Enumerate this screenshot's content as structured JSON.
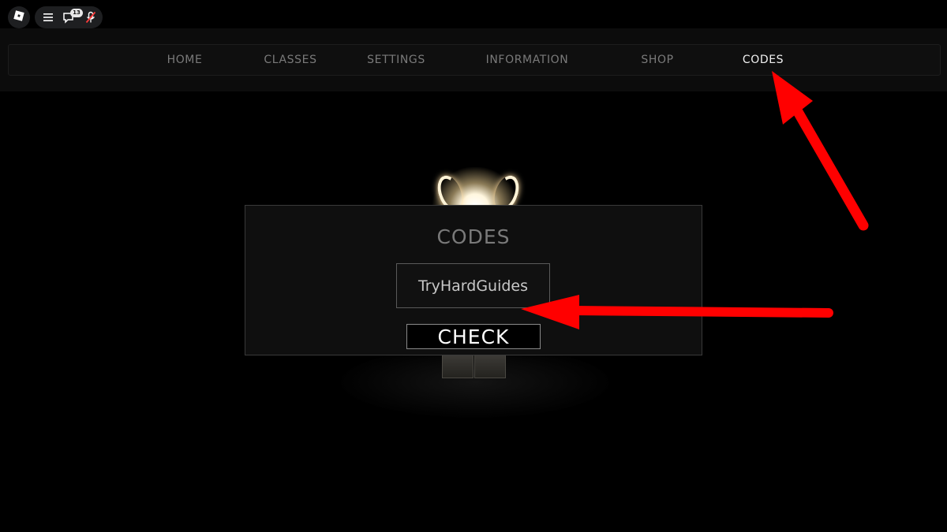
{
  "topbar": {
    "logo_icon": "roblox-logo-icon",
    "menu_icon": "hamburger-menu-icon",
    "chat_icon": "chat-icon",
    "chat_badge": "13",
    "mic_icon": "microphone-muted-icon"
  },
  "nav": {
    "items": [
      {
        "label": "HOME",
        "active": false
      },
      {
        "label": "CLASSES",
        "active": false
      },
      {
        "label": "SETTINGS",
        "active": false
      },
      {
        "label": "INFORMATION",
        "active": false
      },
      {
        "label": "SHOP",
        "active": false
      },
      {
        "label": "CODES",
        "active": true
      }
    ]
  },
  "dialog": {
    "title": "CODES",
    "input_value": "TryHardGuides",
    "check_label": "CHECK"
  },
  "annotations": {
    "arrow_color": "#ff0000",
    "arrow_icon": "red-arrow-icon"
  },
  "colors": {
    "background": "#000000",
    "nav_active": "#f0f0f0",
    "nav_inactive": "#7a7a7a"
  }
}
